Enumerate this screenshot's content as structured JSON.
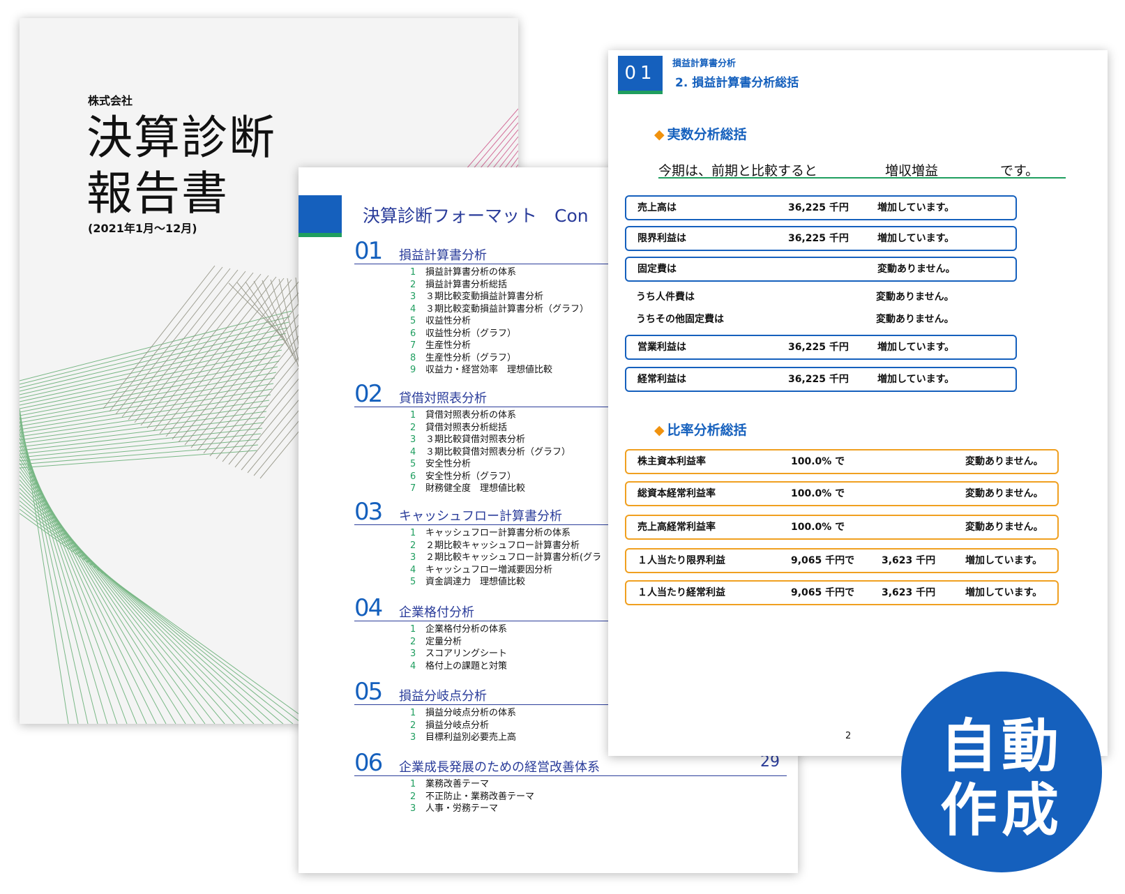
{
  "cover": {
    "company": "株式会社",
    "title_line1": "決算診断",
    "title_line2": "報告書",
    "period": "(2021年1月～12月)"
  },
  "contents": {
    "heading": "決算診断フォーマット　Con",
    "sections": [
      {
        "num": "01",
        "name": "損益計算書分析",
        "page": "",
        "items": [
          {
            "n": "1",
            "t": "損益計算書分析の体系"
          },
          {
            "n": "2",
            "t": "損益計算書分析総括"
          },
          {
            "n": "3",
            "t": "３期比較変動損益計算書分析"
          },
          {
            "n": "4",
            "t": "３期比較変動損益計算書分析（グラフ）"
          },
          {
            "n": "5",
            "t": "収益性分析"
          },
          {
            "n": "6",
            "t": "収益性分析（グラフ）"
          },
          {
            "n": "7",
            "t": "生産性分析"
          },
          {
            "n": "8",
            "t": "生産性分析（グラフ）"
          },
          {
            "n": "9",
            "t": "収益力・経営効率　理想値比較"
          }
        ]
      },
      {
        "num": "02",
        "name": "貸借対照表分析",
        "page": "",
        "items": [
          {
            "n": "1",
            "t": "貸借対照表分析の体系"
          },
          {
            "n": "2",
            "t": "貸借対照表分析総括"
          },
          {
            "n": "3",
            "t": "３期比較貸借対照表分析"
          },
          {
            "n": "4",
            "t": "３期比較貸借対照表分析（グラフ）"
          },
          {
            "n": "5",
            "t": "安全性分析"
          },
          {
            "n": "6",
            "t": "安全性分析（グラフ）"
          },
          {
            "n": "7",
            "t": "財務健全度　理想値比較"
          }
        ]
      },
      {
        "num": "03",
        "name": "キャッシュフロー計算書分析",
        "page": "",
        "items": [
          {
            "n": "1",
            "t": "キャッシュフロー計算書分析の体系"
          },
          {
            "n": "2",
            "t": "２期比較キャッシュフロー計算書分析"
          },
          {
            "n": "3",
            "t": "２期比較キャッシュフロー計算書分析(グラ"
          },
          {
            "n": "4",
            "t": "キャッシュフロー増減要因分析"
          },
          {
            "n": "5",
            "t": "資金調達力　理想値比較"
          }
        ]
      },
      {
        "num": "04",
        "name": "企業格付分析",
        "page": "",
        "items": [
          {
            "n": "1",
            "t": "企業格付分析の体系"
          },
          {
            "n": "2",
            "t": "定量分析"
          },
          {
            "n": "3",
            "t": "スコアリングシート"
          },
          {
            "n": "4",
            "t": "格付上の課題と対策"
          }
        ]
      },
      {
        "num": "05",
        "name": "損益分岐点分析",
        "page": "",
        "items": [
          {
            "n": "1",
            "t": "損益分岐点分析の体系"
          },
          {
            "n": "2",
            "t": "損益分岐点分析"
          },
          {
            "n": "3",
            "t": "目標利益別必要売上高"
          }
        ]
      },
      {
        "num": "06",
        "name": "企業成長発展のための経営改善体系",
        "page": "29",
        "items": [
          {
            "n": "1",
            "t": "業務改善テーマ"
          },
          {
            "n": "2",
            "t": "不正防止・業務改善テーマ"
          },
          {
            "n": "3",
            "t": "人事・労務テーマ"
          }
        ]
      }
    ]
  },
  "summary": {
    "badge": "01",
    "section_small": "損益計算書分析",
    "section_title": "2. 損益計算書分析総括",
    "actual_heading": "実数分析総括",
    "statement_left": "今期は、前期と比較すると",
    "statement_mid": "増収増益",
    "statement_right": "です。",
    "actual_rows": [
      {
        "label": "売上高は",
        "value": "36,225 千円",
        "status": "増加しています。",
        "boxed": true
      },
      {
        "label": "限界利益は",
        "value": "36,225 千円",
        "status": "増加しています。",
        "boxed": true
      },
      {
        "label": "固定費は",
        "value": "",
        "status": "変動ありません。",
        "boxed": true
      },
      {
        "label": "うち人件費は",
        "value": "",
        "status": "変動ありません。",
        "boxed": false
      },
      {
        "label": "うちその他固定費は",
        "value": "",
        "status": "変動ありません。",
        "boxed": false
      },
      {
        "label": "営業利益は",
        "value": "36,225 千円",
        "status": "増加しています。",
        "boxed": true
      },
      {
        "label": "経常利益は",
        "value": "36,225 千円",
        "status": "増加しています。",
        "boxed": true
      }
    ],
    "ratio_heading": "比率分析総括",
    "ratio_rows": [
      {
        "label": "株主資本利益率",
        "value": "100.0% で",
        "extra": "",
        "status": "変動ありません。"
      },
      {
        "label": "総資本経常利益率",
        "value": "100.0% で",
        "extra": "",
        "status": "変動ありません。"
      },
      {
        "label": "売上高経常利益率",
        "value": "100.0% で",
        "extra": "",
        "status": "変動ありません。"
      },
      {
        "label": "１人当たり限界利益",
        "value": "9,065 千円で",
        "extra": "3,623 千円",
        "status": "増加しています。"
      },
      {
        "label": "１人当たり経常利益",
        "value": "9,065 千円で",
        "extra": "3,623 千円",
        "status": "増加しています。"
      }
    ],
    "page_number": "2"
  },
  "badge": {
    "line1": "自動",
    "line2": "作成"
  },
  "colors": {
    "brand_blue": "#1560bd",
    "accent_green": "#1f9e5f",
    "accent_orange": "#f0a020",
    "heading_navy": "#2a3c9a"
  }
}
